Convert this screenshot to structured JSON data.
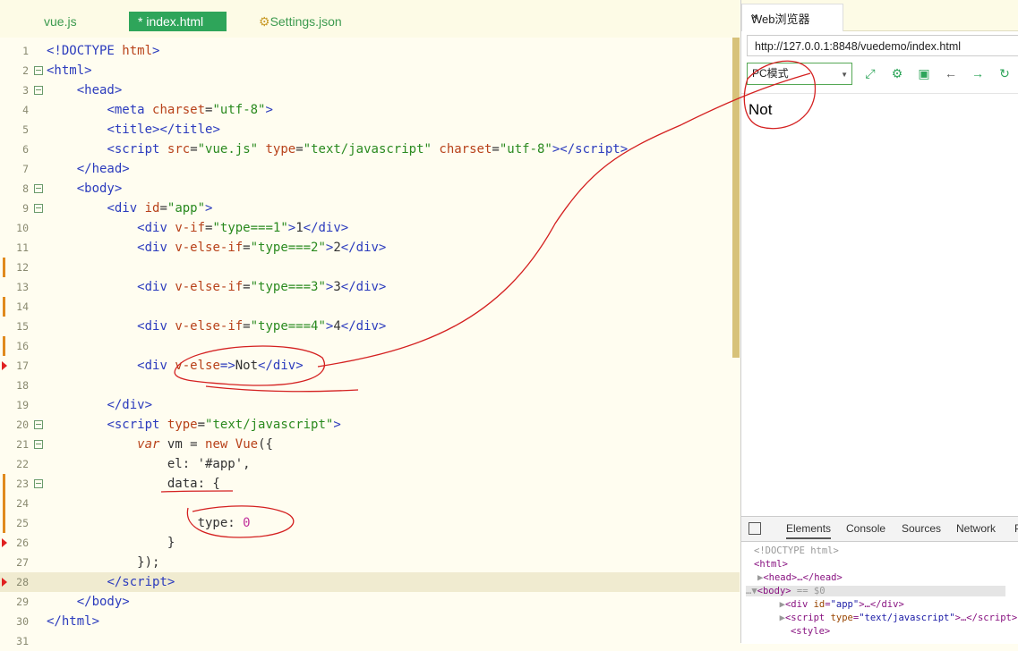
{
  "editor": {
    "tabs": [
      {
        "label": "vue.js"
      },
      {
        "label": "* index.html"
      },
      {
        "label": "Settings.json"
      }
    ],
    "lines": [
      {
        "n": "1",
        "html": "<span class='t'>&lt;!DOCTYPE</span> <span class='a'>html</span><span class='t'>&gt;</span>"
      },
      {
        "n": "2",
        "html": "<span class='t'>&lt;html&gt;</span>"
      },
      {
        "n": "3",
        "html": "    <span class='t'>&lt;head&gt;</span>"
      },
      {
        "n": "4",
        "html": "        <span class='t'>&lt;meta</span> <span class='a'>charset</span><span class='p'>=</span><span class='s'>\"utf-8\"</span><span class='t'>&gt;</span>"
      },
      {
        "n": "5",
        "html": "        <span class='t'>&lt;title&gt;&lt;/title&gt;</span>"
      },
      {
        "n": "6",
        "html": "        <span class='t'>&lt;script</span> <span class='a'>src</span><span class='p'>=</span><span class='s'>\"vue.js\"</span> <span class='a'>type</span><span class='p'>=</span><span class='s'>\"text/javascript\"</span> <span class='a'>charset</span><span class='p'>=</span><span class='s'>\"utf-8\"</span><span class='t'>&gt;&lt;/script&gt;</span>"
      },
      {
        "n": "7",
        "html": "    <span class='t'>&lt;/head&gt;</span>"
      },
      {
        "n": "8",
        "html": "    <span class='t'>&lt;body&gt;</span>"
      },
      {
        "n": "9",
        "html": "        <span class='t'>&lt;div</span> <span class='a'>id</span><span class='p'>=</span><span class='s'>\"app\"</span><span class='t'>&gt;</span>"
      },
      {
        "n": "10",
        "html": "            <span class='t'>&lt;div</span> <span class='a'>v-if</span><span class='p'>=</span><span class='s'>\"type===1\"</span><span class='t'>&gt;</span><span class='p'>1</span><span class='t'>&lt;/div&gt;</span>"
      },
      {
        "n": "11",
        "html": "            <span class='t'>&lt;div</span> <span class='a'>v-else-if</span><span class='p'>=</span><span class='s'>\"type===2\"</span><span class='t'>&gt;</span><span class='p'>2</span><span class='t'>&lt;/div&gt;</span>"
      },
      {
        "n": "12",
        "html": ""
      },
      {
        "n": "13",
        "html": "            <span class='t'>&lt;div</span> <span class='a'>v-else-if</span><span class='p'>=</span><span class='s'>\"type===3\"</span><span class='t'>&gt;</span><span class='p'>3</span><span class='t'>&lt;/div&gt;</span>"
      },
      {
        "n": "14",
        "html": ""
      },
      {
        "n": "15",
        "html": "            <span class='t'>&lt;div</span> <span class='a'>v-else-if</span><span class='p'>=</span><span class='s'>\"type===4\"</span><span class='t'>&gt;</span><span class='p'>4</span><span class='t'>&lt;/div&gt;</span>"
      },
      {
        "n": "16",
        "html": ""
      },
      {
        "n": "17",
        "html": "            <span class='t'>&lt;div</span> <span class='a'>v-else</span><span class='t'>=&gt;</span><span class='p'>Not</span><span class='t'>&lt;/div&gt;</span>"
      },
      {
        "n": "18",
        "html": ""
      },
      {
        "n": "19",
        "html": "        <span class='t'>&lt;/div&gt;</span>"
      },
      {
        "n": "20",
        "html": "        <span class='t'>&lt;script</span> <span class='a'>type</span><span class='p'>=</span><span class='s'>\"text/javascript\"</span><span class='t'>&gt;</span>"
      },
      {
        "n": "21",
        "html": "            <span class='k'>var</span> <span class='p'>vm = </span><span class='a'>new</span> <span class='a'>Vue</span><span class='p'>({</span>"
      },
      {
        "n": "22",
        "html": "                <span class='p'>el: '#app',</span>"
      },
      {
        "n": "23",
        "html": "                <span class='p'>data: {</span>"
      },
      {
        "n": "24",
        "html": ""
      },
      {
        "n": "25",
        "html": "                    <span class='p'>type: </span><span class='n'>0</span>"
      },
      {
        "n": "26",
        "html": "                <span class='p'>}</span>"
      },
      {
        "n": "27",
        "html": "            <span class='p'>});</span>"
      },
      {
        "n": "28",
        "html": "        <span class='t'>&lt;/script&gt;</span>"
      },
      {
        "n": "29",
        "html": "    <span class='t'>&lt;/body&gt;</span>"
      },
      {
        "n": "30",
        "html": "<span class='t'>&lt;/html&gt;</span>"
      },
      {
        "n": "31",
        "html": ""
      }
    ]
  },
  "browser": {
    "tab_title": "Web浏览器",
    "tab_close": "×",
    "url": "http://127.0.0.1:8848/vuedemo/index.html",
    "mode": "PC模式",
    "page_text": "Not",
    "devtools": {
      "tabs": [
        "Elements",
        "Console",
        "Sources",
        "Network",
        "P"
      ],
      "dom_lines": [
        "<span class='g'>&lt;!DOCTYPE html&gt;</span>",
        "&lt;html&gt;",
        "<span class='g'>▶</span>&lt;head&gt;…&lt;/head&gt;",
        "<span class='g'>…▼</span>&lt;body&gt; <span class='g'>== $0</span>",
        "  <span class='g'>▶</span>&lt;div <span class='at'>id</span>=<span class='av'>\"app\"</span>&gt;…&lt;/div&gt;",
        "  <span class='g'>▶</span>&lt;script <span class='at'>type</span>=<span class='av'>\"text/javascript\"</span>&gt;…&lt;/script&gt;",
        "   &lt;style&gt;"
      ]
    }
  }
}
